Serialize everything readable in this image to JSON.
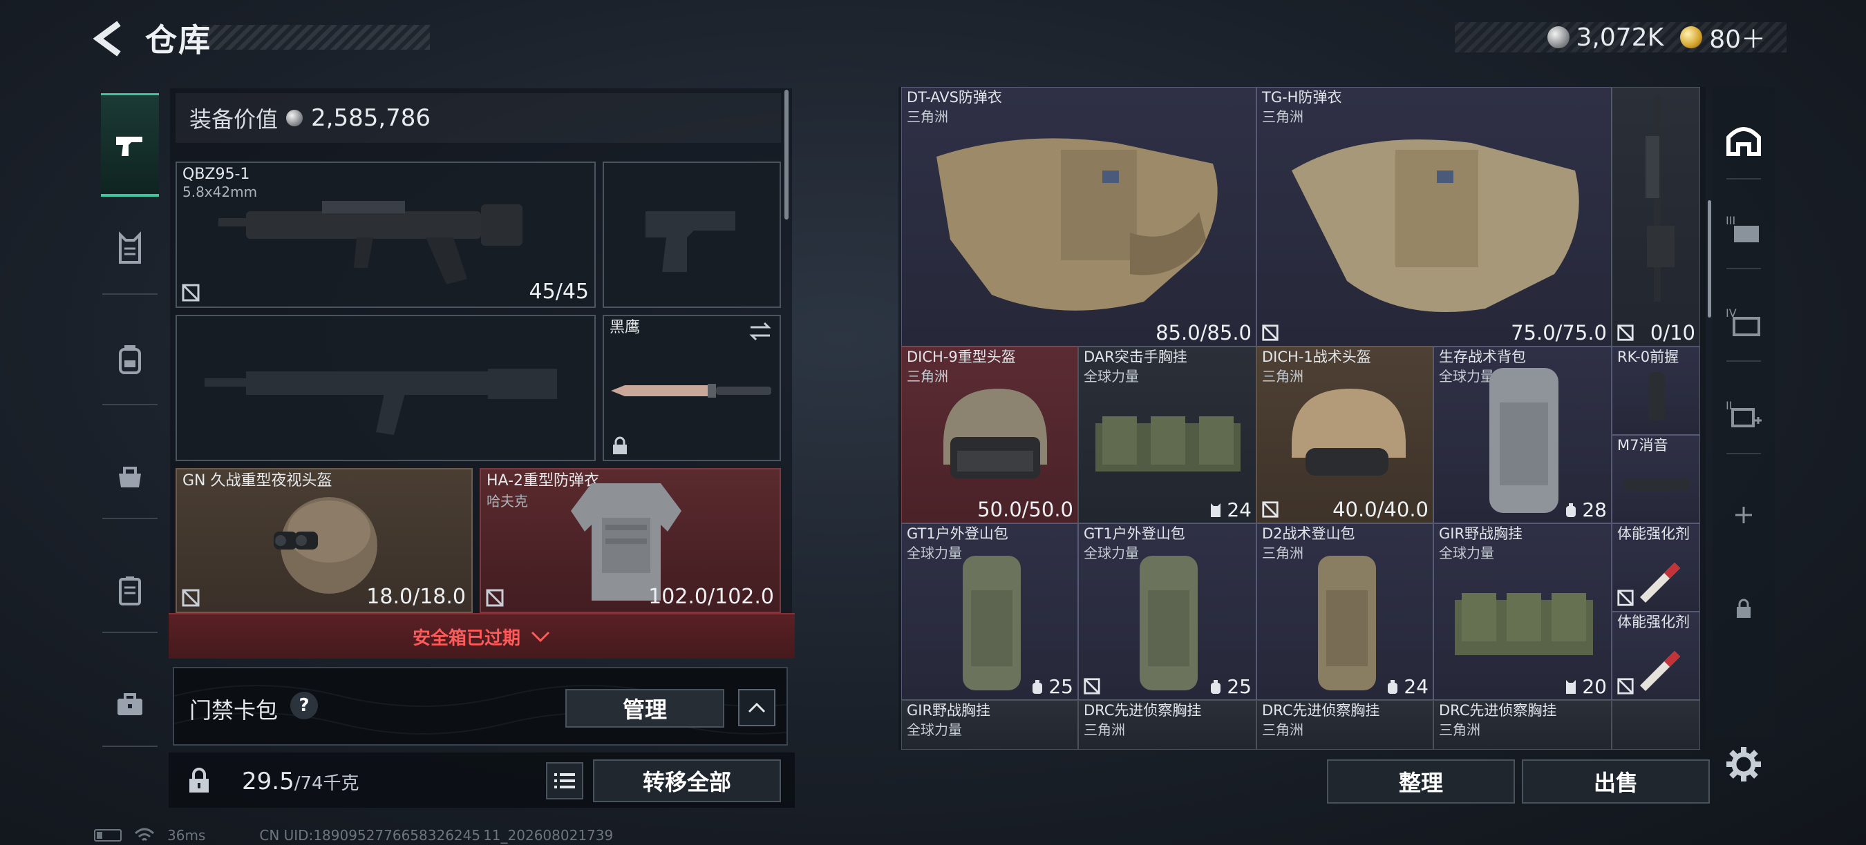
{
  "header": {
    "title": "仓库",
    "currencies": [
      {
        "icon": "silver-coin-icon",
        "value": "3,072K"
      },
      {
        "icon": "gold-coin-icon",
        "value": "80＋"
      }
    ]
  },
  "left_tabs": [
    {
      "name": "tab-weapons",
      "icon": "pistol-icon",
      "active": true
    },
    {
      "name": "tab-vest",
      "icon": "vest-icon",
      "active": false
    },
    {
      "name": "tab-backpack",
      "icon": "backpack-icon",
      "active": false
    },
    {
      "name": "tab-pouch",
      "icon": "pouch-icon",
      "active": false
    },
    {
      "name": "tab-container",
      "icon": "container-icon",
      "active": false
    },
    {
      "name": "tab-case",
      "icon": "briefcase-icon",
      "active": false
    }
  ],
  "loadout": {
    "equip_value_label": "装备价值",
    "equip_value": "2,585,786",
    "primary": {
      "name": "QBZ95-1",
      "caliber": "5.8x42mm",
      "ammo": "45/45"
    },
    "melee": {
      "name": "黑鹰"
    },
    "helmet": {
      "name": "GN 久战重型夜视头盔",
      "durability": "18.0/18.0"
    },
    "armor": {
      "name": "HA-2重型防弹衣",
      "origin": "哈夫克",
      "durability": "102.0/102.0"
    },
    "safebox_text": "安全箱已过期",
    "keycard_label": "门禁卡包",
    "keycard_help": "?",
    "manage_label": "管理",
    "weight_current": "29.5",
    "weight_max": "/74千克",
    "transfer_all_label": "转移全部"
  },
  "stash": {
    "items": [
      {
        "name": "DT-AVS防弹衣",
        "origin": "三角洲",
        "value": "85.0/85.0"
      },
      {
        "name": "TG-H防弹衣",
        "origin": "三角洲",
        "value": "75.0/75.0"
      },
      {
        "name": "",
        "origin": "",
        "value": "0/10"
      },
      {
        "name": "DICH-9重型头盔",
        "origin": "三角洲",
        "value": "50.0/50.0"
      },
      {
        "name": "DAR突击手胸挂",
        "origin": "全球力量",
        "value": "24"
      },
      {
        "name": "DICH-1战术头盔",
        "origin": "三角洲",
        "value": "40.0/40.0"
      },
      {
        "name": "生存战术背包",
        "origin": "全球力量",
        "value": "28"
      },
      {
        "name": "RK-0前握",
        "origin": "",
        "value": ""
      },
      {
        "name": "M7消音",
        "origin": "",
        "value": ""
      },
      {
        "name": "GT1户外登山包",
        "origin": "全球力量",
        "value": "25"
      },
      {
        "name": "GT1户外登山包",
        "origin": "全球力量",
        "value": "25"
      },
      {
        "name": "D2战术登山包",
        "origin": "三角洲",
        "value": "24"
      },
      {
        "name": "GIR野战胸挂",
        "origin": "全球力量",
        "value": "20"
      },
      {
        "name": "体能强化剂",
        "origin": "",
        "value": ""
      },
      {
        "name": "体能强化剂",
        "origin": "",
        "value": ""
      },
      {
        "name": "GIR野战胸挂",
        "origin": "全球力量",
        "value": ""
      },
      {
        "name": "DRC先进侦察胸挂",
        "origin": "三角洲",
        "value": ""
      },
      {
        "name": "DRC先进侦察胸挂",
        "origin": "三角洲",
        "value": ""
      },
      {
        "name": "DRC先进侦察胸挂",
        "origin": "三角洲",
        "value": ""
      }
    ],
    "sort_label": "整理",
    "sell_label": "出售"
  },
  "right_tools": [
    {
      "name": "stash-home-tool",
      "icon": "house-icon"
    },
    {
      "name": "stash-iii-tool",
      "icon": "stash-iii-icon"
    },
    {
      "name": "stash-iv-tool",
      "icon": "stash-iv-icon"
    },
    {
      "name": "stash-ii-add-tool",
      "icon": "stash-ii-add-icon"
    },
    {
      "name": "add-stash-tool",
      "icon": "plus-icon"
    },
    {
      "name": "locked-stash-tool",
      "icon": "lock-icon"
    }
  ],
  "status": {
    "ping": "36ms",
    "uid": "CN UID:1890952776658326245 11_202608021739"
  },
  "colors": {
    "accent": "#3fc49d",
    "warning": "#ff5a5a",
    "rarity_purple": "#2f3046",
    "rarity_red": "#5b2b33",
    "rarity_brown": "#4e4034"
  }
}
